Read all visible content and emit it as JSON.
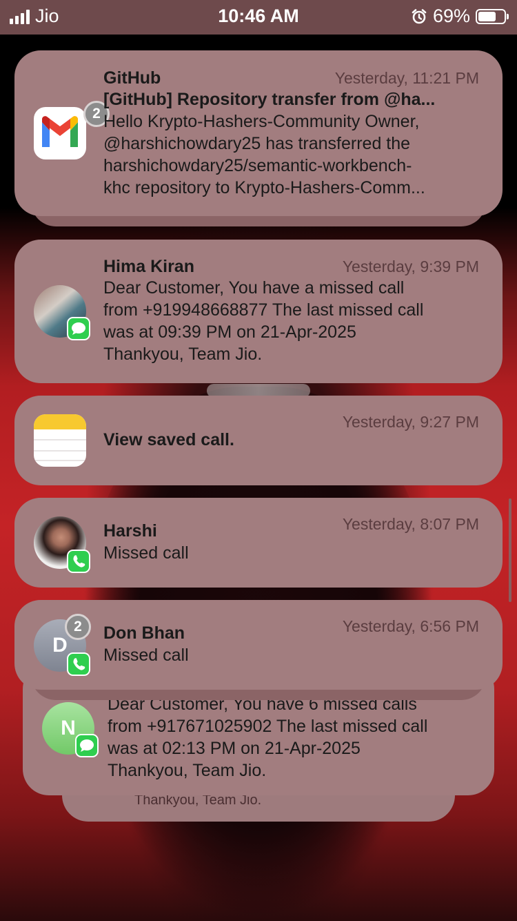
{
  "status_bar": {
    "carrier": "Jio",
    "time": "10:46 AM",
    "battery_percent": "69%",
    "battery_level": 0.69
  },
  "notifications": [
    {
      "app": "gmail",
      "icon": "gmail-icon",
      "badge": "2",
      "title": "GitHub",
      "time": "Yesterday, 11:21 PM",
      "subject": "[GitHub] Repository transfer from @ha...",
      "lines": [
        "Hello Krypto-Hashers-Community Owner,",
        "@harshichowdary25 has transferred the",
        "harshichowdary25/semantic-workbench-",
        "khc repository to Krypto-Hashers-Comm..."
      ]
    },
    {
      "app": "messages",
      "icon": "messages-icon",
      "title": "Hima Kiran",
      "time": "Yesterday, 9:39 PM",
      "lines": [
        "Dear Customer, You have a missed call",
        "from +919948668877 The last missed call",
        "was at 09:39 PM on 21-Apr-2025",
        "Thankyou, Team Jio."
      ]
    },
    {
      "app": "notes",
      "icon": "notes-icon",
      "title": "View saved call.",
      "time": "Yesterday, 9:27 PM"
    },
    {
      "app": "phone",
      "icon": "phone-icon",
      "title": "Harshi",
      "time": "Yesterday, 8:07 PM",
      "lines": [
        "Missed call"
      ]
    },
    {
      "app": "phone",
      "icon": "phone-icon",
      "badge": "2",
      "avatar_letter": "D",
      "title": "Don Bhan",
      "time": "Yesterday, 6:56 PM",
      "lines": [
        "Missed call"
      ]
    },
    {
      "app": "messages",
      "icon": "messages-icon",
      "avatar_letter": "N",
      "lines": [
        "Dear Customer, You have 6 missed calls",
        "from +917671025902 The last missed call",
        "was at 02:13 PM on 21-Apr-2025",
        "Thankyou, Team Jio."
      ]
    }
  ],
  "stack_peek_text": "Thankyou, Team Jio."
}
